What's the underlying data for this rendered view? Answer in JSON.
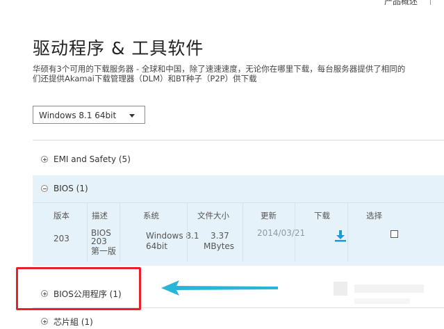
{
  "top_nav": {
    "product_overview": "产品概述"
  },
  "page": {
    "title": "驱动程序 & 工具软件",
    "description_line1": "华硕有3个可用的下载服务器 - 全球和中国，除了速速速度，无论你在哪里下载，每台服务器提供了相同的",
    "description_line2": "们还提供Akamai下载管理器（DLM）和BT种子（P2P）供下载"
  },
  "os_select": {
    "value": "Windows 8.1 64bit"
  },
  "categories": [
    {
      "label": "EMI and Safety  (5)",
      "expanded": false
    },
    {
      "label": "BIOS (1)",
      "expanded": true
    },
    {
      "label": "BIOS公用程序 (1)",
      "expanded": false
    },
    {
      "label": "芯片組 (1)",
      "expanded": false
    }
  ],
  "table": {
    "headers": [
      "版本",
      "描述",
      "系统",
      "文件大小",
      "更新",
      "下载",
      "选择"
    ],
    "rows": [
      {
        "version": "203",
        "description": [
          "BIOS",
          "203",
          "第一版"
        ],
        "system": [
          "Windows 8.1",
          "64bit"
        ],
        "size": [
          "3.37",
          "MBytes"
        ],
        "updated": "2014/03/21"
      }
    ]
  },
  "colors": {
    "accent_blue": "#1c9ad6",
    "highlight_red": "#e8202a",
    "arrow_cyan": "#29b5d8",
    "panel_bg": "#e6f2f9"
  },
  "icons": {
    "expand": "plus-circle-icon",
    "collapse": "minus-circle-icon",
    "download": "download-icon",
    "dropdown": "caret-down-icon"
  }
}
